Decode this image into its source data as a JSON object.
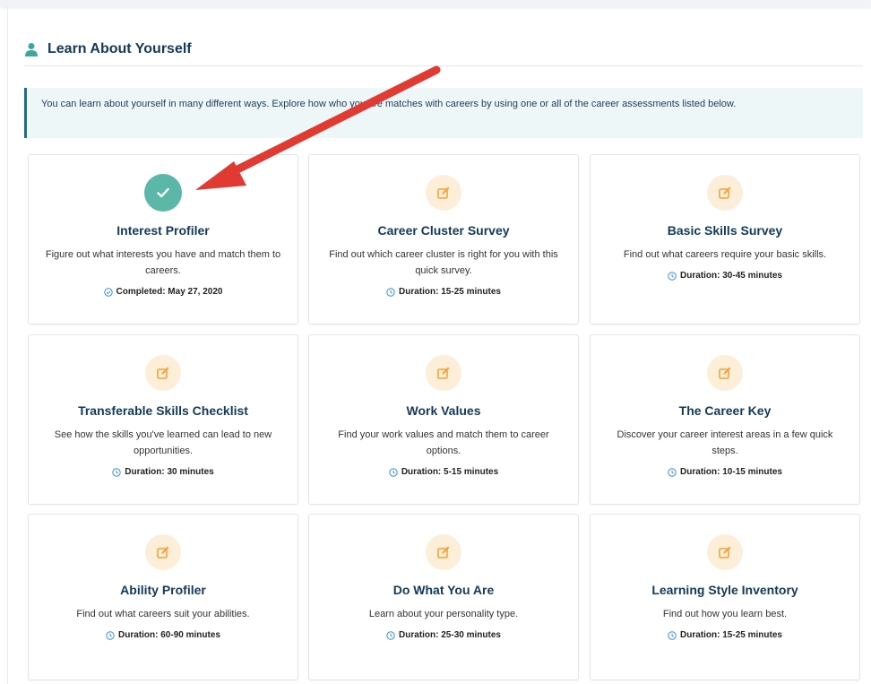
{
  "section": {
    "title": "Learn About Yourself",
    "icon": "user-icon",
    "intro": "You can learn about yourself in many different ways. Explore how who you are matches with careers by using one or all of the career assessments listed below."
  },
  "colors": {
    "heading": "#123a5c",
    "accent_teal": "#5bb8a8",
    "icon_bg": "#fdeeda",
    "icon_orange": "#f4a338",
    "annotation_arrow": "#e03a32"
  },
  "assessments": [
    {
      "title": "Interest Profiler",
      "description": "Figure out what interests you have and match them to careers.",
      "meta": "Completed: May 27, 2020",
      "status": "completed",
      "icon": "check-icon"
    },
    {
      "title": "Career Cluster Survey",
      "description": "Find out which career cluster is right for you with this quick survey.",
      "meta": "Duration: 15-25 minutes",
      "status": "not-started",
      "icon": "edit-icon"
    },
    {
      "title": "Basic Skills Survey",
      "description": "Find out what careers require your basic skills.",
      "meta": "Duration: 30-45 minutes",
      "status": "not-started",
      "icon": "edit-icon"
    },
    {
      "title": "Transferable Skills Checklist",
      "description": "See how the skills you've learned can lead to new opportunities.",
      "meta": "Duration: 30 minutes",
      "status": "not-started",
      "icon": "edit-icon"
    },
    {
      "title": "Work Values",
      "description": "Find your work values and match them to career options.",
      "meta": "Duration: 5-15 minutes",
      "status": "not-started",
      "icon": "edit-icon"
    },
    {
      "title": "The Career Key",
      "description": "Discover your career interest areas in a few quick steps.",
      "meta": "Duration: 10-15 minutes",
      "status": "not-started",
      "icon": "edit-icon"
    },
    {
      "title": "Ability Profiler",
      "description": "Find out what careers suit your abilities.",
      "meta": "Duration: 60-90 minutes",
      "status": "not-started",
      "icon": "edit-icon"
    },
    {
      "title": "Do What You Are",
      "description": "Learn about your personality type.",
      "meta": "Duration: 25-30 minutes",
      "status": "not-started",
      "icon": "edit-icon"
    },
    {
      "title": "Learning Style Inventory",
      "description": "Find out how you learn best.",
      "meta": "Duration: 15-25 minutes",
      "status": "not-started",
      "icon": "edit-icon"
    }
  ]
}
